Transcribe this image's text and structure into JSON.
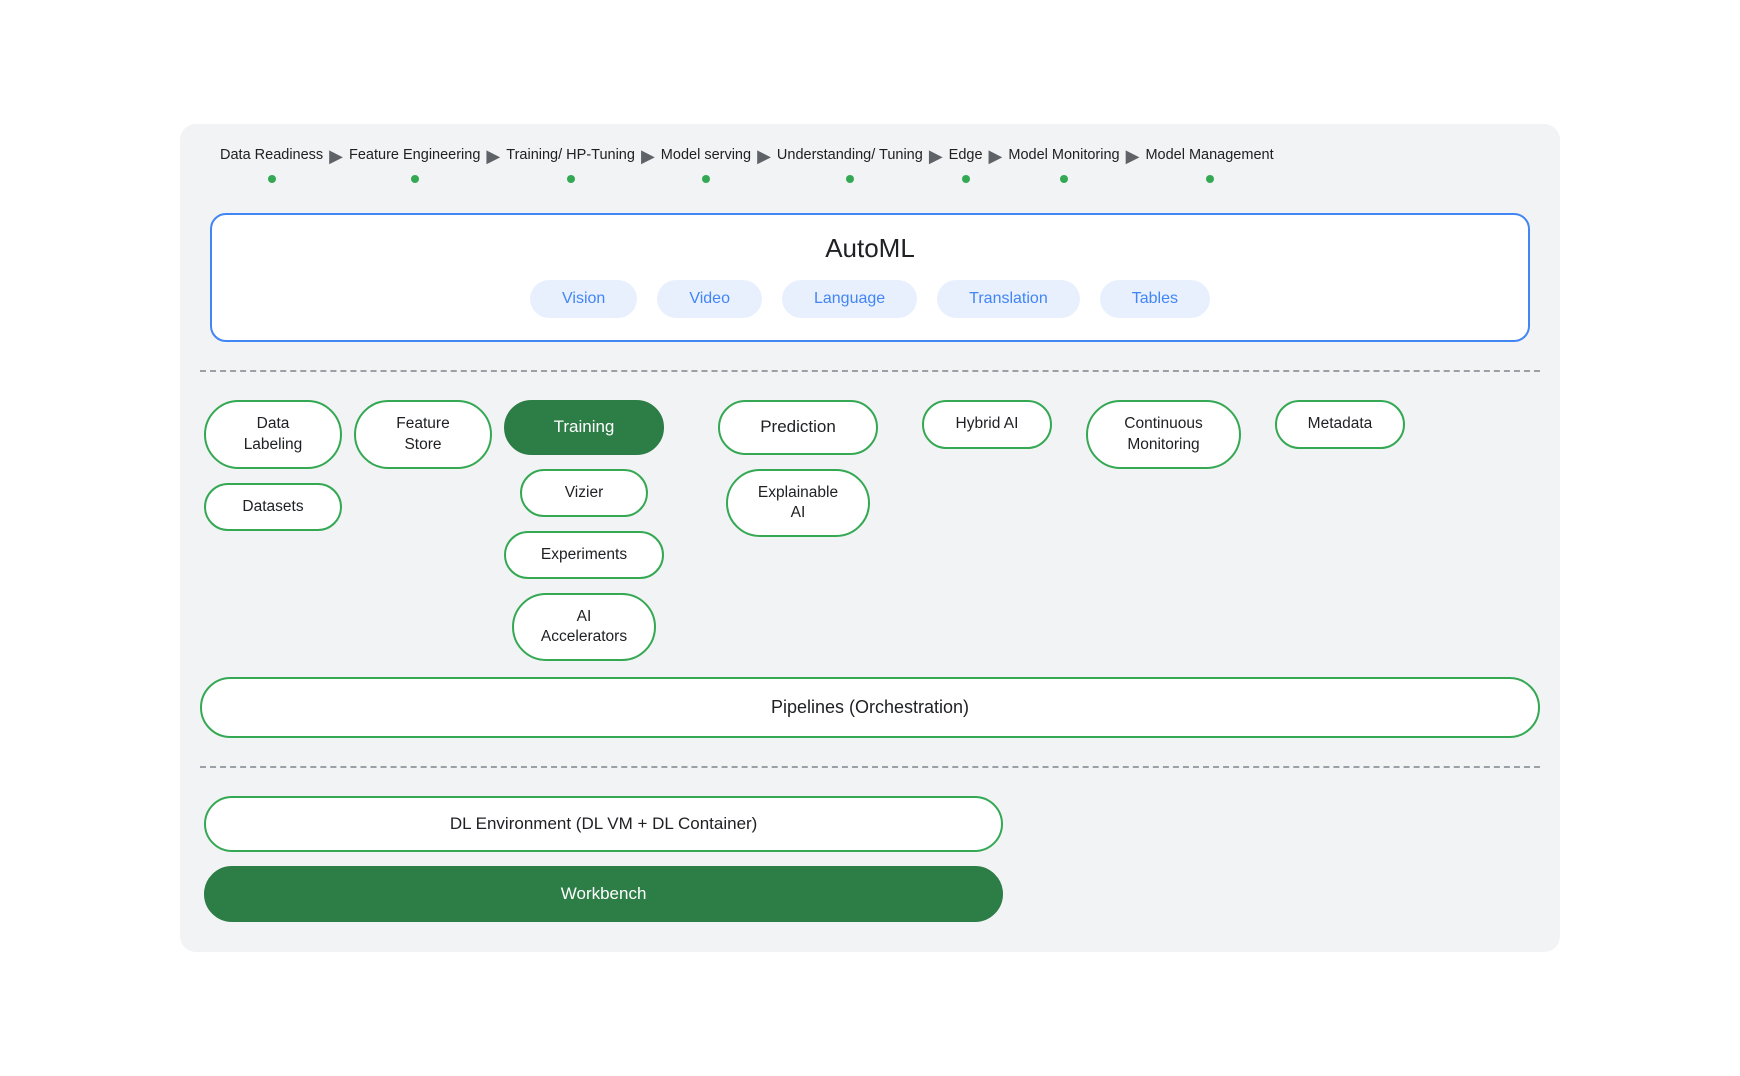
{
  "header": {
    "steps": [
      {
        "id": "data-readiness",
        "label": "Data\nReadiness"
      },
      {
        "id": "feature-engineering",
        "label": "Feature\nEngineering"
      },
      {
        "id": "training-hp-tuning",
        "label": "Training/\nHP-Tuning"
      },
      {
        "id": "model-serving",
        "label": "Model\nserving"
      },
      {
        "id": "understanding-tuning",
        "label": "Understanding/\nTuning"
      },
      {
        "id": "edge",
        "label": "Edge"
      },
      {
        "id": "model-monitoring",
        "label": "Model\nMonitoring"
      },
      {
        "id": "model-management",
        "label": "Model\nManagement"
      }
    ]
  },
  "automl": {
    "title": "AutoML",
    "pills": [
      "Vision",
      "Video",
      "Language",
      "Translation",
      "Tables"
    ]
  },
  "row1": {
    "items": [
      {
        "id": "data-labeling",
        "label": "Data\nLabeling",
        "filled": false
      },
      {
        "id": "feature-store",
        "label": "Feature\nStore",
        "filled": false
      },
      {
        "id": "training",
        "label": "Training",
        "filled": true
      },
      {
        "id": "prediction",
        "label": "Prediction",
        "filled": false
      },
      {
        "id": "hybrid-ai",
        "label": "Hybrid AI",
        "filled": false
      },
      {
        "id": "continuous-monitoring",
        "label": "Continuous\nMonitoring",
        "filled": false
      },
      {
        "id": "metadata",
        "label": "Metadata",
        "filled": false
      }
    ]
  },
  "row2": {
    "items": [
      {
        "id": "datasets",
        "label": "Datasets",
        "filled": false
      },
      {
        "id": "vizier",
        "label": "Vizier",
        "filled": false
      },
      {
        "id": "explainable-ai",
        "label": "Explainable\nAI",
        "filled": false
      }
    ]
  },
  "row3": {
    "items": [
      {
        "id": "experiments",
        "label": "Experiments",
        "filled": false
      },
      {
        "id": "ai-accelerators",
        "label": "AI\nAccelerators",
        "filled": false
      }
    ]
  },
  "orchestration": {
    "label": "Pipelines (Orchestration)"
  },
  "dl_environment": {
    "label": "DL Environment (DL VM + DL Container)"
  },
  "workbench": {
    "label": "Workbench"
  },
  "colors": {
    "green_dark": "#2d7d46",
    "green_border": "#34a853",
    "blue_border": "#4285f4",
    "blue_fill": "#e8f0fe",
    "blue_text": "#4285f4"
  }
}
